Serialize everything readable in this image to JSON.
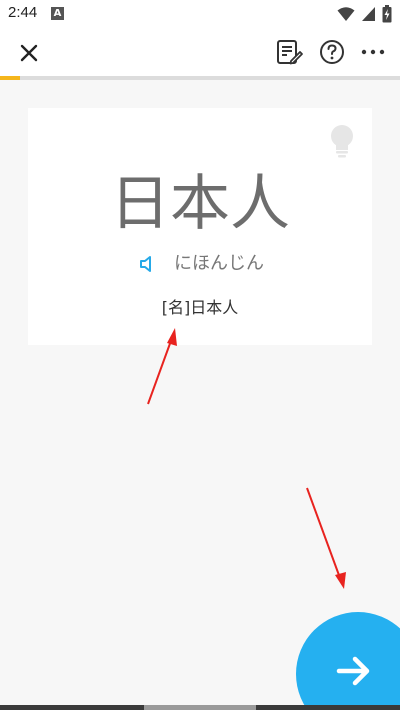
{
  "status_bar": {
    "time": "2:44",
    "icons": [
      "a-notification-icon",
      "wifi-icon",
      "cellular-signal-icon",
      "battery-charging-icon"
    ]
  },
  "top_bar": {
    "icons": [
      "close-icon",
      "notes-edit-icon",
      "help-icon",
      "more-options-icon"
    ]
  },
  "progress": {
    "fraction": 0.05,
    "fill_color": "#f5b61c",
    "track_color": "#dcdcdc"
  },
  "card": {
    "word": "日本人",
    "reading": "にほんじん",
    "meaning": "[名]日本人",
    "icons": [
      "lightbulb-hint-icon",
      "speaker-icon"
    ]
  },
  "next_button": {
    "icon": "arrow-right-icon",
    "color": "#25b0f0"
  },
  "annotation": {
    "arrow_color": "#e8231f"
  }
}
